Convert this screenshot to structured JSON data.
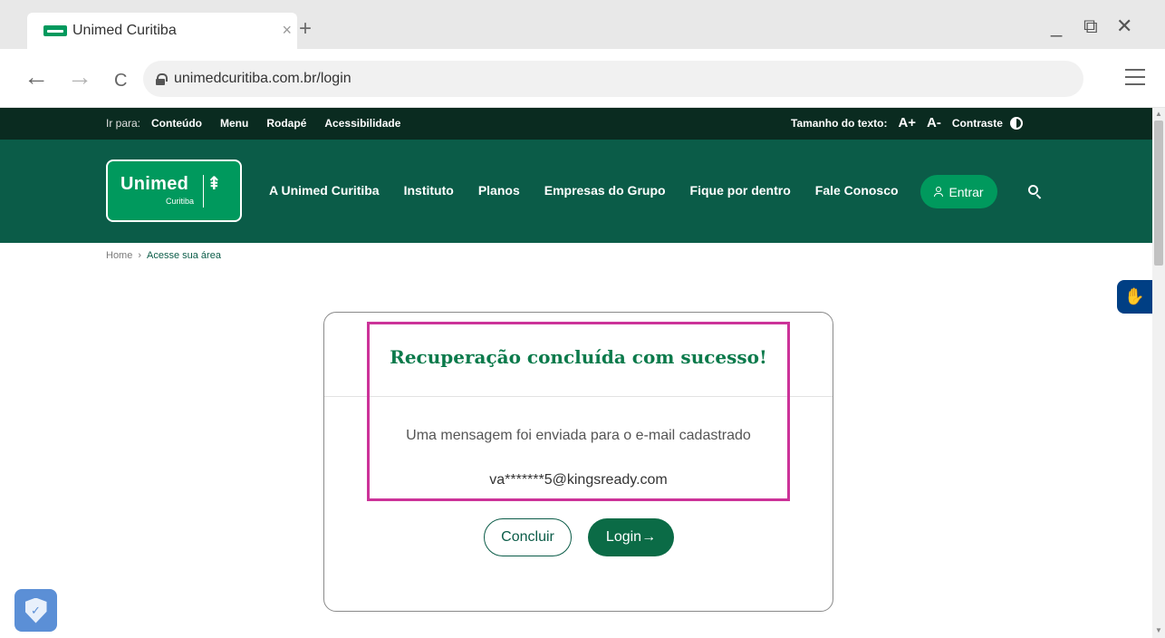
{
  "browser": {
    "tab_title": "Unimed Curitiba",
    "tab_close": "×",
    "new_tab": "+",
    "minimize": "_",
    "restore": "⧉",
    "close": "✕",
    "back": "←",
    "forward": "→",
    "reload": "C",
    "url": "unimedcuritiba.com.br/login"
  },
  "utility_bar": {
    "go_to_label": "Ir para:",
    "links": [
      "Conteúdo",
      "Menu",
      "Rodapé",
      "Acessibilidade"
    ],
    "text_size_label": "Tamanho do texto:",
    "increase": "A+",
    "decrease": "A-",
    "contrast": "Contraste"
  },
  "header": {
    "logo_word": "Unimed",
    "logo_tree": "⇞",
    "logo_sub": "Curitiba",
    "nav": [
      "A Unimed Curitiba",
      "Instituto",
      "Planos",
      "Empresas do Grupo",
      "Fique por dentro",
      "Fale Conosco"
    ],
    "login_button": "Entrar"
  },
  "breadcrumb": {
    "home": "Home",
    "separator": "›",
    "current": "Acesse sua área"
  },
  "a11y_widget": {
    "icon": "✋"
  },
  "card": {
    "title": "Recuperação concluída com sucesso!",
    "message": "Uma mensagem foi enviada para o e-mail cadastrado",
    "email": "va*******5@kingsready.com",
    "button_done": "Concluir",
    "button_login": "Login→"
  },
  "privacy_widget": {
    "icon": "✓"
  },
  "colors": {
    "brand_green": "#00995d",
    "header_green": "#0b5c48",
    "utility_dark": "#0a2b20",
    "highlight": "#cc3399",
    "a11y_blue": "#003f84"
  }
}
